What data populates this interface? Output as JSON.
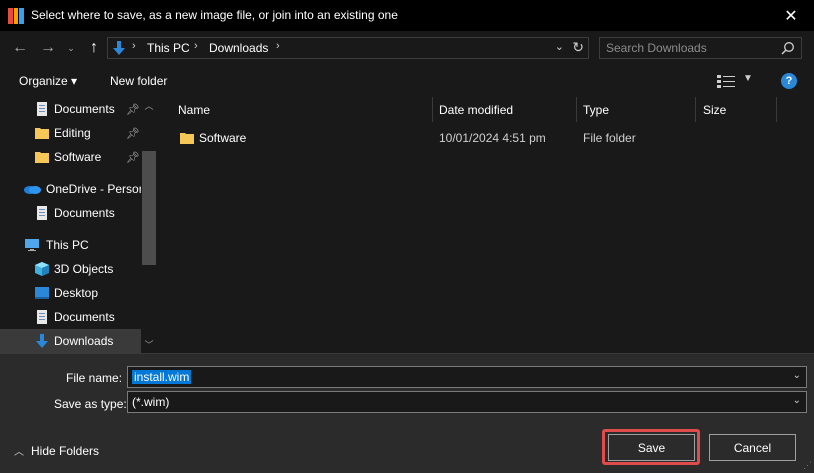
{
  "window": {
    "title": "Select where to save, as a new image file, or join into an existing one",
    "close_glyph": "✕",
    "icon": "app-color-grid-icon",
    "icon_colors": [
      "#e84c3d",
      "#f2a400",
      "#3aa0e8"
    ]
  },
  "address": {
    "crumbs": [
      "This PC",
      "Downloads"
    ],
    "separator": "›",
    "search_placeholder": "Search Downloads"
  },
  "toolbar": {
    "organize_label": "Organize ▾",
    "new_folder_label": "New folder",
    "help_label": "?"
  },
  "navpane": {
    "items": [
      {
        "label": "Documents",
        "icon": "document-icon",
        "pinned": true
      },
      {
        "label": "Editing",
        "icon": "folder-icon",
        "pinned": true
      },
      {
        "label": "Software",
        "icon": "folder-icon",
        "pinned": true
      },
      {
        "label": "OneDrive - Persor",
        "icon": "onedrive-cloud-icon",
        "pinned": false
      },
      {
        "label": "Documents",
        "icon": "document-icon",
        "pinned": false
      },
      {
        "label": "This PC",
        "icon": "computer-icon",
        "pinned": false
      },
      {
        "label": "3D Objects",
        "icon": "cube-icon",
        "pinned": false
      },
      {
        "label": "Desktop",
        "icon": "desktop-icon",
        "pinned": false
      },
      {
        "label": "Documents",
        "icon": "document-icon",
        "pinned": false
      },
      {
        "label": "Downloads",
        "icon": "download-arrow-icon",
        "pinned": false,
        "selected": true
      }
    ]
  },
  "filelist": {
    "columns": [
      "Name",
      "Date modified",
      "Type",
      "Size"
    ],
    "rows": [
      {
        "name": "Software",
        "date": "10/01/2024 4:51 pm",
        "type": "File folder",
        "size": ""
      }
    ]
  },
  "form": {
    "filename_label": "File name:",
    "filename_value": "install.wim",
    "savetype_label": "Save as type:",
    "savetype_value": "(*.wim)"
  },
  "footer": {
    "hide_folders_label": "Hide Folders",
    "save_label": "Save",
    "cancel_label": "Cancel"
  },
  "colors": {
    "accent": "#0078d7",
    "highlight_outline": "#e04b4b",
    "folder": "#f4c756"
  }
}
